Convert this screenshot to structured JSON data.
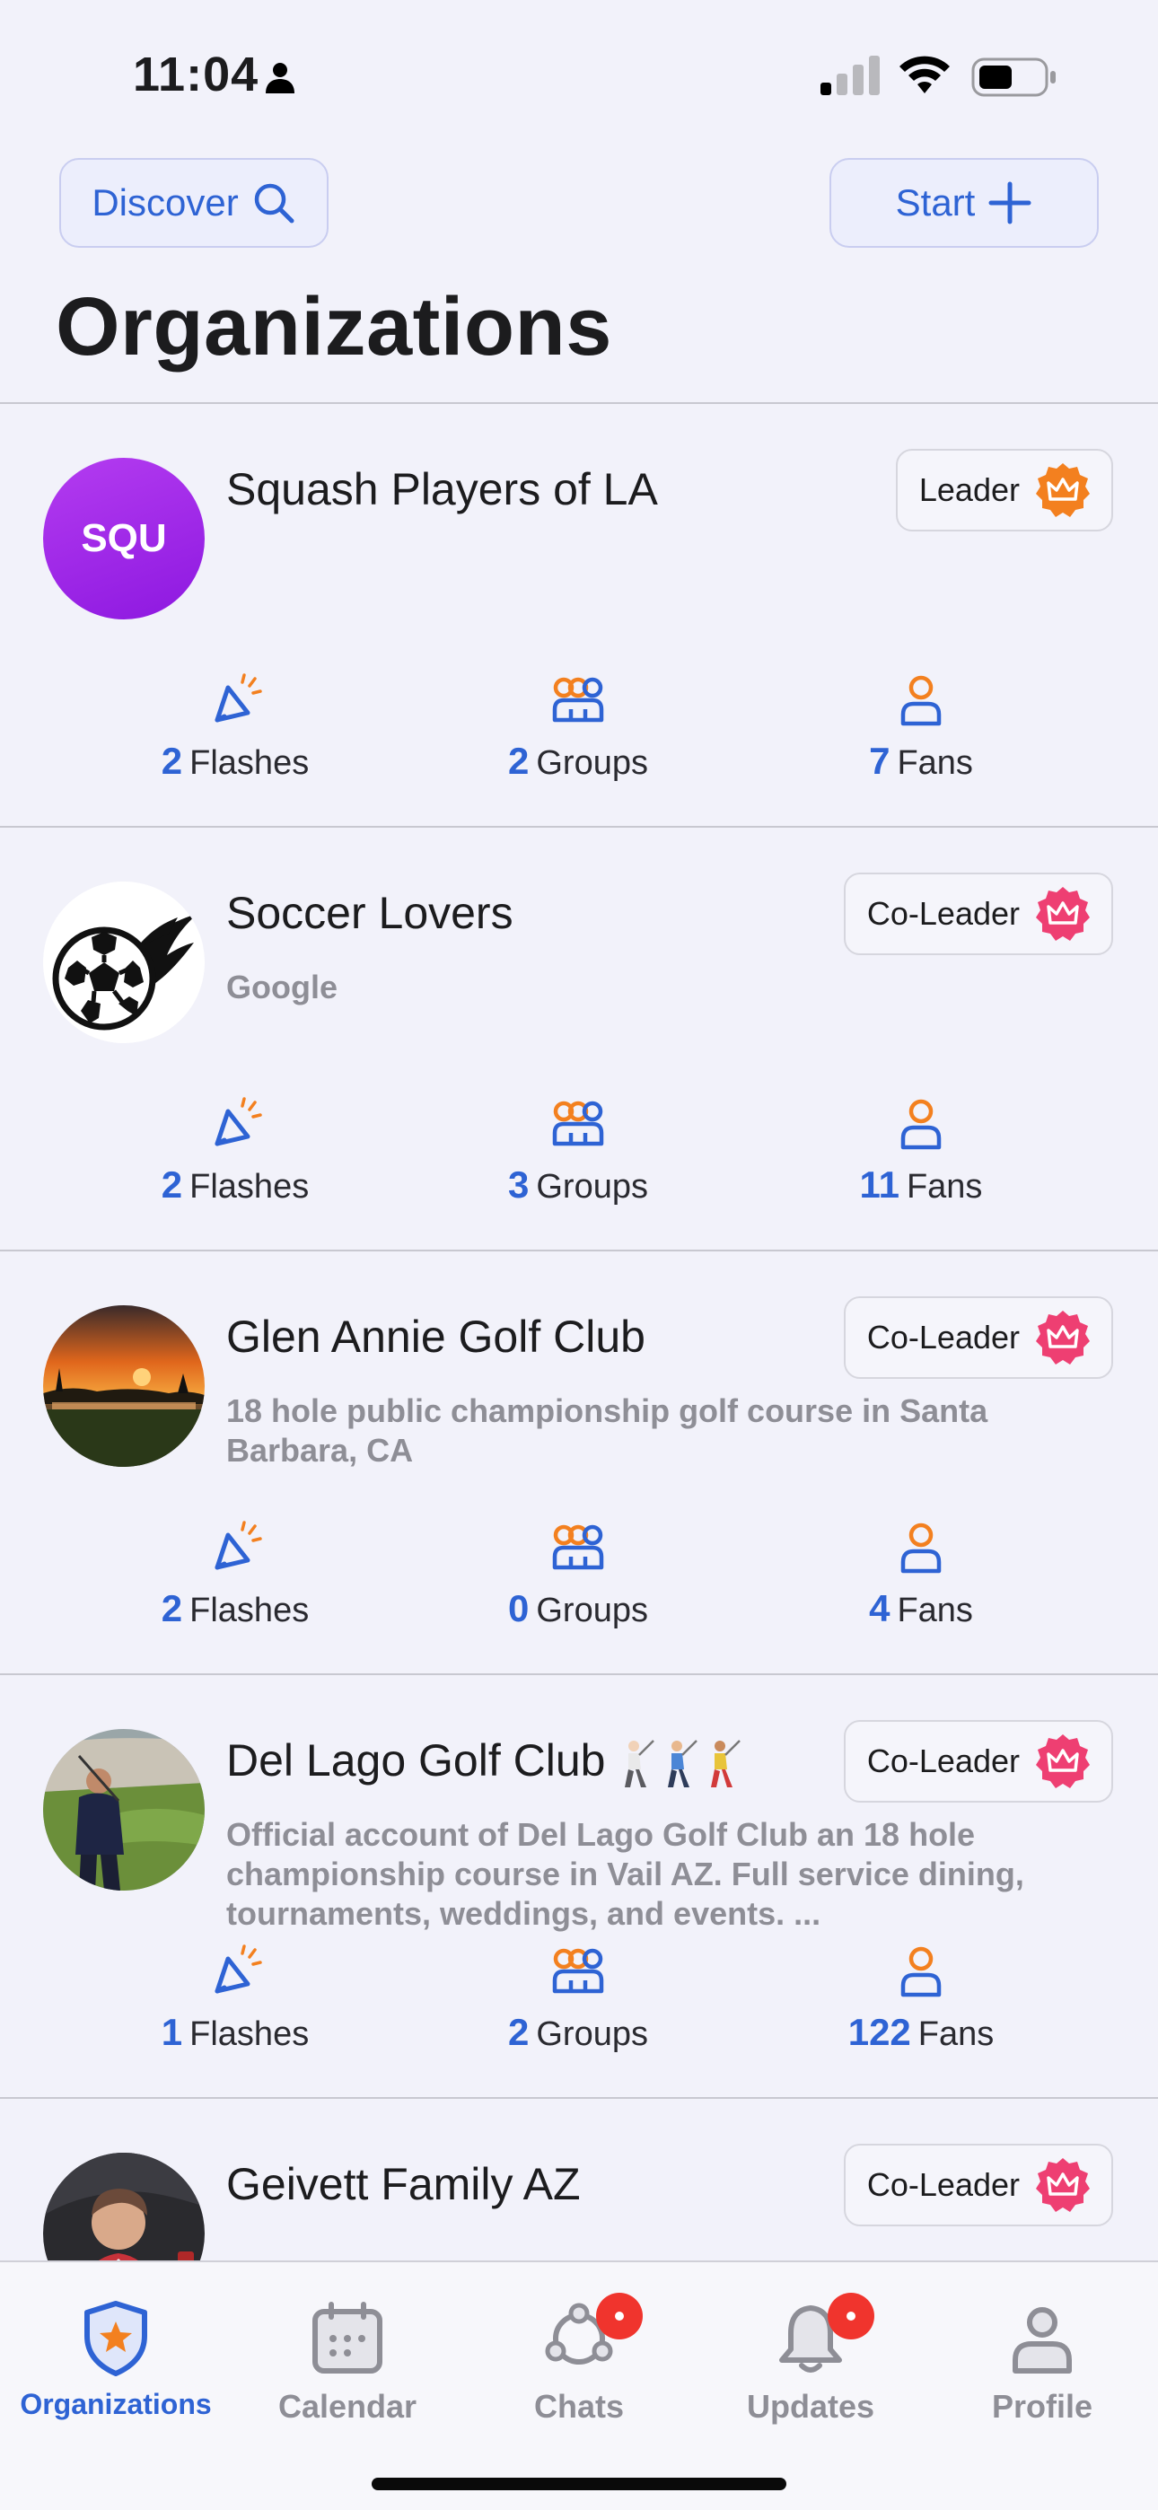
{
  "status_bar": {
    "time": "11:04"
  },
  "header": {
    "discover_label": "Discover",
    "start_label": "Start",
    "title": "Organizations"
  },
  "organizations": [
    {
      "avatar_text": "SQU",
      "name": "Squash Players of LA",
      "description": "",
      "role": "Leader",
      "role_color": "#f3801f",
      "flashes": "2",
      "flashes_label": "Flashes",
      "groups": "2",
      "groups_label": "Groups",
      "fans": "7",
      "fans_label": "Fans"
    },
    {
      "avatar_icon": "soccer-ball-icon",
      "name": "Soccer Lovers",
      "description": "Google",
      "role": "Co-Leader",
      "role_color": "#ee3f72",
      "flashes": "2",
      "flashes_label": "Flashes",
      "groups": "3",
      "groups_label": "Groups",
      "fans": "11",
      "fans_label": "Fans"
    },
    {
      "avatar_icon": "sunset-golf-photo",
      "name": "Glen Annie Golf Club",
      "description": "18 hole public championship golf course in Santa Barbara, CA",
      "role": "Co-Leader",
      "role_color": "#ee3f72",
      "flashes": "2",
      "flashes_label": "Flashes",
      "groups": "0",
      "groups_label": "Groups",
      "fans": "4",
      "fans_label": "Fans"
    },
    {
      "avatar_icon": "golfer-photo",
      "name": "Del Lago Golf Club",
      "name_emojis": [
        "🏌🏻",
        "🏌🏼",
        "🏌🏽"
      ],
      "description": "Official account of Del Lago Golf Club an 18 hole championship course in Vail AZ. Full service dining, tournaments, weddings, and events. ...",
      "role": "Co-Leader",
      "role_color": "#ee3f72",
      "flashes": "1",
      "flashes_label": "Flashes",
      "groups": "2",
      "groups_label": "Groups",
      "fans": "122",
      "fans_label": "Fans"
    },
    {
      "avatar_icon": "person-photo",
      "name": "Geivett Family AZ",
      "description": "",
      "role": "Co-Leader",
      "role_color": "#ee3f72"
    }
  ],
  "tab_bar": {
    "tabs": [
      {
        "label": "Organizations",
        "icon": "shield-star-icon",
        "active": true
      },
      {
        "label": "Calendar",
        "icon": "calendar-icon"
      },
      {
        "label": "Chats",
        "icon": "chat-nodes-icon",
        "badge": true
      },
      {
        "label": "Updates",
        "icon": "bell-icon",
        "badge": true
      },
      {
        "label": "Profile",
        "icon": "profile-icon"
      }
    ]
  },
  "colors": {
    "accent": "#2e63d4",
    "orange": "#f3801f",
    "pink": "#ee3f72",
    "badge_red": "#f0342d"
  }
}
